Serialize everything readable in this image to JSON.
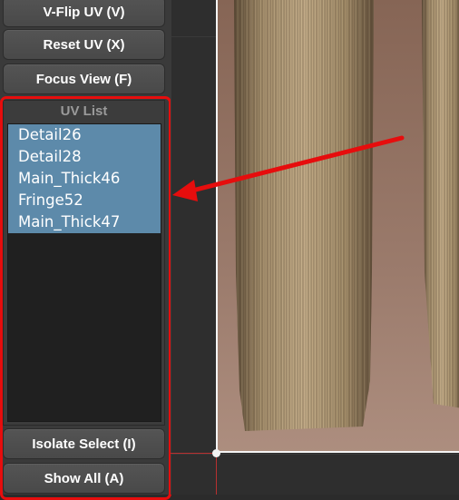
{
  "toolbar": {
    "vflip_label": "V-Flip UV (V)",
    "reset_label": "Reset UV (X)",
    "focus_label": "Focus View (F)"
  },
  "uv_panel": {
    "title": "UV List",
    "items": [
      "Detail26",
      "Detail28",
      "Main_Thick46",
      "Fringe52",
      "Main_Thick47"
    ]
  },
  "bottom_buttons": {
    "isolate_label": "Isolate Select (I)",
    "show_all_label": "Show All (A)"
  },
  "colors": {
    "highlight": "#e60d0d",
    "selection": "#5d8aaa",
    "frame": "#f4f4f4"
  },
  "icons": {
    "annotation": "arrow-pointer"
  }
}
